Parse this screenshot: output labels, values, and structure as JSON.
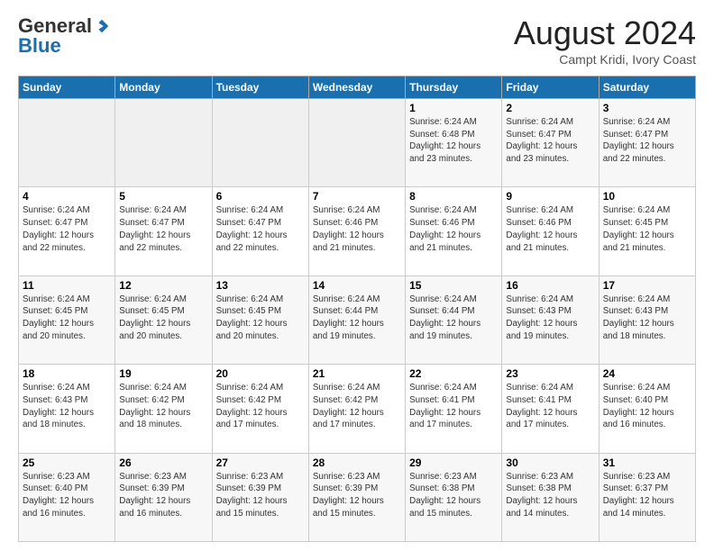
{
  "logo": {
    "general": "General",
    "blue": "Blue"
  },
  "title": "August 2024",
  "location": "Campt Kridi, Ivory Coast",
  "days": [
    "Sunday",
    "Monday",
    "Tuesday",
    "Wednesday",
    "Thursday",
    "Friday",
    "Saturday"
  ],
  "weeks": [
    [
      {
        "date": "",
        "info": ""
      },
      {
        "date": "",
        "info": ""
      },
      {
        "date": "",
        "info": ""
      },
      {
        "date": "",
        "info": ""
      },
      {
        "date": "1",
        "info": "Sunrise: 6:24 AM\nSunset: 6:48 PM\nDaylight: 12 hours\nand 23 minutes."
      },
      {
        "date": "2",
        "info": "Sunrise: 6:24 AM\nSunset: 6:47 PM\nDaylight: 12 hours\nand 23 minutes."
      },
      {
        "date": "3",
        "info": "Sunrise: 6:24 AM\nSunset: 6:47 PM\nDaylight: 12 hours\nand 22 minutes."
      }
    ],
    [
      {
        "date": "4",
        "info": "Sunrise: 6:24 AM\nSunset: 6:47 PM\nDaylight: 12 hours\nand 22 minutes."
      },
      {
        "date": "5",
        "info": "Sunrise: 6:24 AM\nSunset: 6:47 PM\nDaylight: 12 hours\nand 22 minutes."
      },
      {
        "date": "6",
        "info": "Sunrise: 6:24 AM\nSunset: 6:47 PM\nDaylight: 12 hours\nand 22 minutes."
      },
      {
        "date": "7",
        "info": "Sunrise: 6:24 AM\nSunset: 6:46 PM\nDaylight: 12 hours\nand 21 minutes."
      },
      {
        "date": "8",
        "info": "Sunrise: 6:24 AM\nSunset: 6:46 PM\nDaylight: 12 hours\nand 21 minutes."
      },
      {
        "date": "9",
        "info": "Sunrise: 6:24 AM\nSunset: 6:46 PM\nDaylight: 12 hours\nand 21 minutes."
      },
      {
        "date": "10",
        "info": "Sunrise: 6:24 AM\nSunset: 6:45 PM\nDaylight: 12 hours\nand 21 minutes."
      }
    ],
    [
      {
        "date": "11",
        "info": "Sunrise: 6:24 AM\nSunset: 6:45 PM\nDaylight: 12 hours\nand 20 minutes."
      },
      {
        "date": "12",
        "info": "Sunrise: 6:24 AM\nSunset: 6:45 PM\nDaylight: 12 hours\nand 20 minutes."
      },
      {
        "date": "13",
        "info": "Sunrise: 6:24 AM\nSunset: 6:45 PM\nDaylight: 12 hours\nand 20 minutes."
      },
      {
        "date": "14",
        "info": "Sunrise: 6:24 AM\nSunset: 6:44 PM\nDaylight: 12 hours\nand 19 minutes."
      },
      {
        "date": "15",
        "info": "Sunrise: 6:24 AM\nSunset: 6:44 PM\nDaylight: 12 hours\nand 19 minutes."
      },
      {
        "date": "16",
        "info": "Sunrise: 6:24 AM\nSunset: 6:43 PM\nDaylight: 12 hours\nand 19 minutes."
      },
      {
        "date": "17",
        "info": "Sunrise: 6:24 AM\nSunset: 6:43 PM\nDaylight: 12 hours\nand 18 minutes."
      }
    ],
    [
      {
        "date": "18",
        "info": "Sunrise: 6:24 AM\nSunset: 6:43 PM\nDaylight: 12 hours\nand 18 minutes."
      },
      {
        "date": "19",
        "info": "Sunrise: 6:24 AM\nSunset: 6:42 PM\nDaylight: 12 hours\nand 18 minutes."
      },
      {
        "date": "20",
        "info": "Sunrise: 6:24 AM\nSunset: 6:42 PM\nDaylight: 12 hours\nand 17 minutes."
      },
      {
        "date": "21",
        "info": "Sunrise: 6:24 AM\nSunset: 6:42 PM\nDaylight: 12 hours\nand 17 minutes."
      },
      {
        "date": "22",
        "info": "Sunrise: 6:24 AM\nSunset: 6:41 PM\nDaylight: 12 hours\nand 17 minutes."
      },
      {
        "date": "23",
        "info": "Sunrise: 6:24 AM\nSunset: 6:41 PM\nDaylight: 12 hours\nand 17 minutes."
      },
      {
        "date": "24",
        "info": "Sunrise: 6:24 AM\nSunset: 6:40 PM\nDaylight: 12 hours\nand 16 minutes."
      }
    ],
    [
      {
        "date": "25",
        "info": "Sunrise: 6:23 AM\nSunset: 6:40 PM\nDaylight: 12 hours\nand 16 minutes."
      },
      {
        "date": "26",
        "info": "Sunrise: 6:23 AM\nSunset: 6:39 PM\nDaylight: 12 hours\nand 16 minutes."
      },
      {
        "date": "27",
        "info": "Sunrise: 6:23 AM\nSunset: 6:39 PM\nDaylight: 12 hours\nand 15 minutes."
      },
      {
        "date": "28",
        "info": "Sunrise: 6:23 AM\nSunset: 6:39 PM\nDaylight: 12 hours\nand 15 minutes."
      },
      {
        "date": "29",
        "info": "Sunrise: 6:23 AM\nSunset: 6:38 PM\nDaylight: 12 hours\nand 15 minutes."
      },
      {
        "date": "30",
        "info": "Sunrise: 6:23 AM\nSunset: 6:38 PM\nDaylight: 12 hours\nand 14 minutes."
      },
      {
        "date": "31",
        "info": "Sunrise: 6:23 AM\nSunset: 6:37 PM\nDaylight: 12 hours\nand 14 minutes."
      }
    ]
  ]
}
